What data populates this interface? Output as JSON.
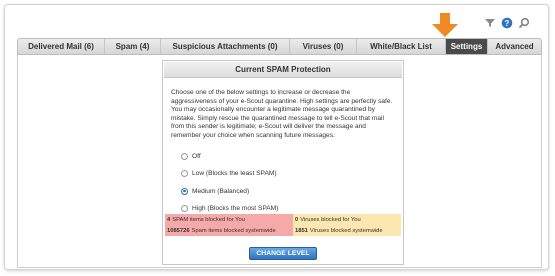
{
  "header": {
    "icons": [
      "filter-icon",
      "help-icon",
      "search-icon"
    ]
  },
  "tabs": [
    {
      "label": "Delivered Mail (6)",
      "active": false
    },
    {
      "label": "Spam (4)",
      "active": false
    },
    {
      "label": "Suspicious Attachments (0)",
      "active": false
    },
    {
      "label": "Viruses (0)",
      "active": false
    },
    {
      "label": "White/Black List",
      "active": false
    },
    {
      "label": "Settings",
      "active": true
    },
    {
      "label": "Advanced",
      "active": false
    }
  ],
  "protection": {
    "title": "Current SPAM Protection",
    "description": "Choose one of the below settings to increase or decrease the aggressiveness of your e-Scout quarantine. High settings are perfectly safe. You may occasionally encounter a legitimate message quarantined by mistake. Simply rescue the quarantined message to tell e-Scout that mail from this sender is legitimate; e-Scout will deliver the message and remember your choice when scanning future messages.",
    "options": [
      {
        "label": "Off",
        "selected": false
      },
      {
        "label": "Low (Blocks the least SPAM)",
        "selected": false
      },
      {
        "label": "Medium (Balanced)",
        "selected": true
      },
      {
        "label": "High (Blocks the most SPAM)",
        "selected": false
      }
    ],
    "stats": {
      "spam_you_count": "4",
      "spam_you_label": "SPAM items blocked for You",
      "virus_you_count": "0",
      "virus_you_label": "Viruses blocked for You",
      "spam_system_count": "1085726",
      "spam_system_label": "Spam items blocked systemwide",
      "virus_system_count": "1851",
      "virus_system_label": "Viruses blocked systemwide"
    },
    "button_label": "CHANGE LEVEL"
  },
  "colors": {
    "arrow": "#f08a24",
    "active_tab": "#4a4a4a",
    "button": "#2f73bf",
    "stat_red": "#f6a9a9",
    "stat_yellow": "#fde7b0"
  }
}
